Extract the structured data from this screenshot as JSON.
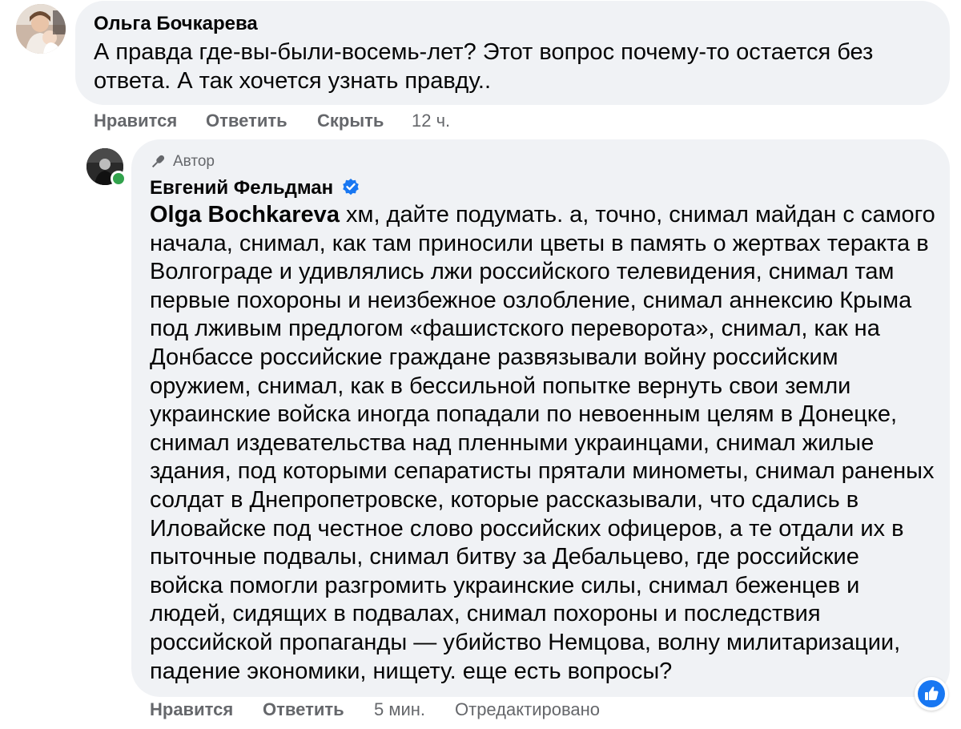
{
  "comment1": {
    "author": "Ольга Бочкарева",
    "text": "А правда где-вы-были-восемь-лет? Этот вопрос почему-то остается без ответа. А так хочется узнать правду..",
    "actions": {
      "like": "Нравится",
      "reply": "Ответить",
      "hide": "Скрыть",
      "time": "12 ч."
    }
  },
  "comment2": {
    "badge": "Автор",
    "author": "Евгений Фельдман",
    "mention": "Olga Bochkareva",
    "text": " хм, дайте подумать. а, точно, снимал майдан с самого начала, снимал, как там приносили цветы в память о жертвах теракта в Волгограде и удивлялись лжи российского телевидения, снимал там первые похороны и неизбежное озлобление, снимал аннексию Крыма под лживым предлогом «фашистского переворота», снимал, как на Донбассе российские граждане развязывали войну российским оружием, снимал, как в бессильной попытке вернуть свои земли украинские войска иногда попадали по невоенным целям в Донецке, снимал издевательства над пленными украинцами, снимал жилые здания, под которыми сепаратисты прятали минометы, снимал раненых солдат в Днепропетровске, которые рассказывали, что сдались в Иловайске под честное слово российских офицеров, а те отдали их в пыточные подвалы, снимал битву за Дебальцево, где российские войска помогли разгромить украинские силы, снимал беженцев и людей, сидящих в подвалах, снимал похороны и последствия российской пропаганды — убийство Немцова, волну милитаризации, падение экономики, нищету. еще есть вопросы?",
    "actions": {
      "like": "Нравится",
      "reply": "Ответить",
      "time": "5 мин.",
      "edited": "Отредактировано"
    }
  },
  "colors": {
    "bubble": "#f0f2f5",
    "secondary_text": "#65676b",
    "verified": "#1877f2",
    "online": "#31a24c",
    "reaction": "#1877f2"
  },
  "icons": {
    "author_badge": "microphone-icon",
    "verified": "verified-check-icon",
    "reaction": "thumbs-up-icon"
  }
}
